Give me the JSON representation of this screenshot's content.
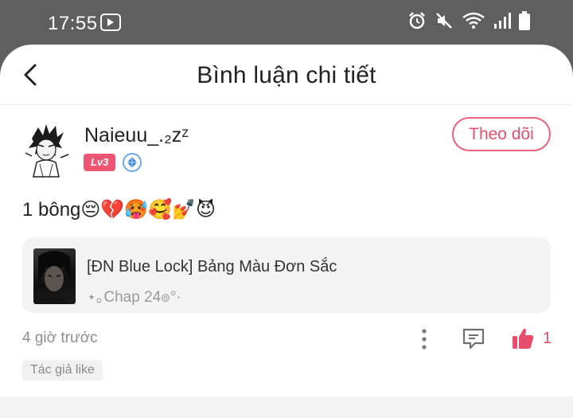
{
  "status_bar": {
    "time": "17:55"
  },
  "header": {
    "title": "Bình luận chi tiết"
  },
  "user": {
    "name": "Naieuu_.₂zᶻ",
    "level": "Lv3",
    "follow_label": "Theo dõi"
  },
  "comment": {
    "text": "1 bông😔💔🥵🥰💅😈"
  },
  "story": {
    "title": "[ĐN Blue Lock] Bảng Màu Đơn Sắc",
    "chapter": "⋆｡Chap 24๏°·"
  },
  "meta": {
    "time_ago": "4 giờ trước",
    "like_count": "1",
    "author_like": "Tác giả like"
  },
  "colors": {
    "accent": "#e84e6a",
    "status_bar_bg": "#5f5f5f",
    "card_bg": "#f3f3f4",
    "level_badge": "#ee5572"
  }
}
